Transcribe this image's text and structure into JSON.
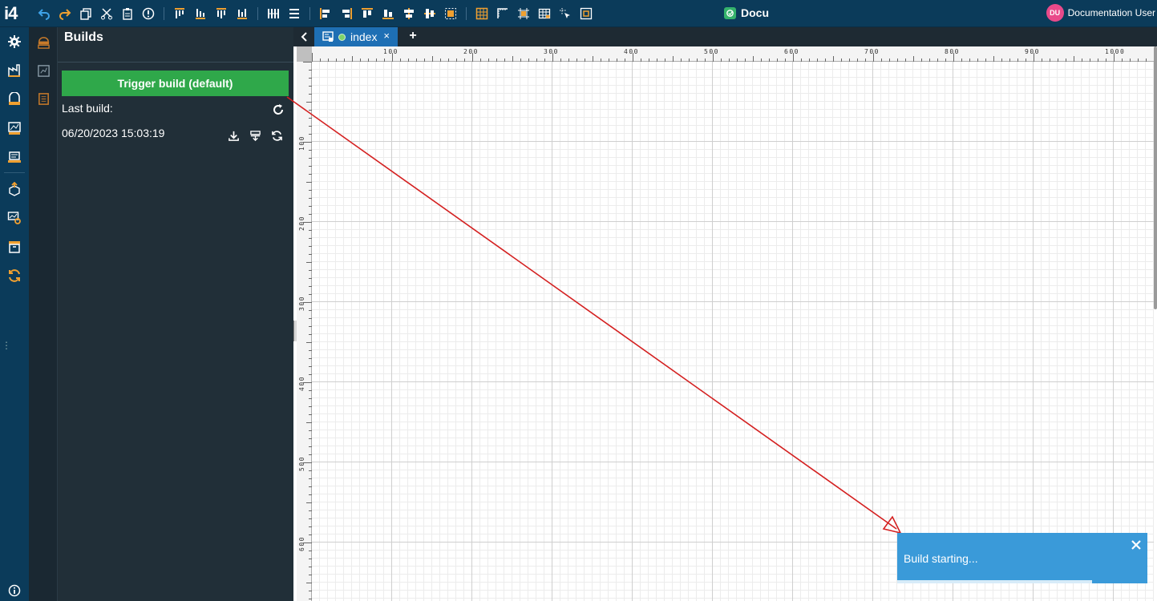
{
  "app": {
    "logo": "i4",
    "title": "Docu",
    "user_initials": "DU",
    "user_name": "Documentation User"
  },
  "toolbar": {
    "icons": [
      "undo-icon",
      "redo-icon",
      "copy-icon",
      "cut-icon",
      "paste-icon",
      "info-circle-icon",
      "align-top-icon",
      "align-bottom-icon",
      "align-middle-icon",
      "align-baseline-icon",
      "distribute-horizontal-icon",
      "distribute-vertical-icon",
      "align-left-icon",
      "align-right-icon",
      "align-top-edge-icon",
      "align-bottom-edge-icon",
      "align-center-h-icon",
      "align-center-v-icon",
      "group-icon",
      "grid-icon",
      "ruler-icon",
      "snap-icon",
      "table-icon",
      "select-icon",
      "fit-icon"
    ]
  },
  "panel": {
    "title": "Builds",
    "trigger_label": "Trigger build (default)",
    "last_build_label": "Last build:",
    "build_date": "06/20/2023 15:03:19"
  },
  "tabs": [
    {
      "label": "index",
      "close": "×"
    }
  ],
  "tab_add": "+",
  "rulers": {
    "h_labels": [
      "100",
      "200",
      "300",
      "400",
      "500",
      "600",
      "700",
      "800",
      "900",
      "1000"
    ],
    "v_labels": [
      "100",
      "200",
      "300",
      "400",
      "500",
      "600"
    ]
  },
  "toast": {
    "message": "Build starting...",
    "progress": 0.78
  },
  "colors": {
    "topbar": "#0b3b5a",
    "panel": "#212f38",
    "trigger": "#2fa84a",
    "tab_active": "#1e6fb4",
    "toast": "#3a9ad9",
    "arrow": "#d42020",
    "toolbar_orange": "#f0a030",
    "toolbar_blue": "#3ea2e8"
  }
}
